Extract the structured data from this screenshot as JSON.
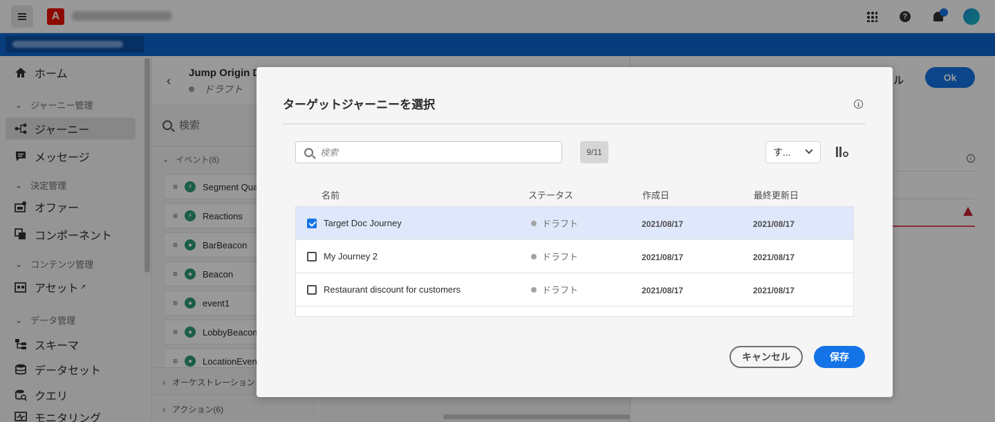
{
  "header": {
    "menu_icon": "hamburger-icon",
    "logo_letter": "A",
    "org_name": "",
    "icons": [
      "apps-grid-icon",
      "help-icon",
      "bell-icon",
      "avatar"
    ]
  },
  "sidebar": {
    "items": [
      {
        "label": "ホーム",
        "icon": "home-icon"
      },
      {
        "label": "ジャーニー",
        "icon": "journey-icon",
        "active": true
      },
      {
        "label": "メッセージ",
        "icon": "message-icon"
      },
      {
        "label": "オファー",
        "icon": "offer-icon"
      },
      {
        "label": "コンポーネント",
        "icon": "component-icon"
      },
      {
        "label": "アセット",
        "icon": "asset-icon"
      },
      {
        "label": "スキーマ",
        "icon": "schema-icon"
      },
      {
        "label": "データセット",
        "icon": "dataset-icon"
      },
      {
        "label": "クエリ",
        "icon": "query-icon"
      },
      {
        "label": "モニタリング",
        "icon": "monitoring-icon"
      }
    ],
    "sections": {
      "journey_mgmt": "ジャーニー管理",
      "decision_mgmt": "決定管理",
      "content_mgmt": "コンテンツ管理",
      "data_mgmt": "データ管理"
    }
  },
  "journey": {
    "title": "Jump Origin Do",
    "status": "ドラフト",
    "palette": {
      "search_label": "検索",
      "events_category": "イベント(8)",
      "events": [
        "Segment Qua",
        "Reactions",
        "BarBeacon",
        "Beacon",
        "event1",
        "LobbyBeacon",
        "LocationEven"
      ],
      "orchestration_category": "オーケストレーション",
      "actions_category": "アクション(6)"
    }
  },
  "right_panel": {
    "cancel_label": "ル",
    "ok_label": "Ok"
  },
  "modal": {
    "title": "ターゲットジャーニーを選択",
    "search_placeholder": "検索",
    "count": "9/11",
    "filter_value": "す...",
    "columns": {
      "name": "名前",
      "status": "ステータス",
      "created": "作成日",
      "modified": "最終更新日"
    },
    "rows": [
      {
        "name": "Target Doc Journey",
        "status": "ドラフト",
        "created": "2021/08/17",
        "modified": "2021/08/17",
        "checked": true
      },
      {
        "name": "My Journey 2",
        "status": "ドラフト",
        "created": "2021/08/17",
        "modified": "2021/08/17",
        "checked": false
      },
      {
        "name": "Restaurant discount for customers",
        "status": "ドラフト",
        "created": "2021/08/17",
        "modified": "2021/08/17",
        "checked": false
      }
    ],
    "cancel_label": "キャンセル",
    "save_label": "保存"
  },
  "colors": {
    "accent": "#1473e6",
    "header_bar": "#0d66d0",
    "selected_row": "#dfe8fa",
    "error": "#c9252d"
  }
}
